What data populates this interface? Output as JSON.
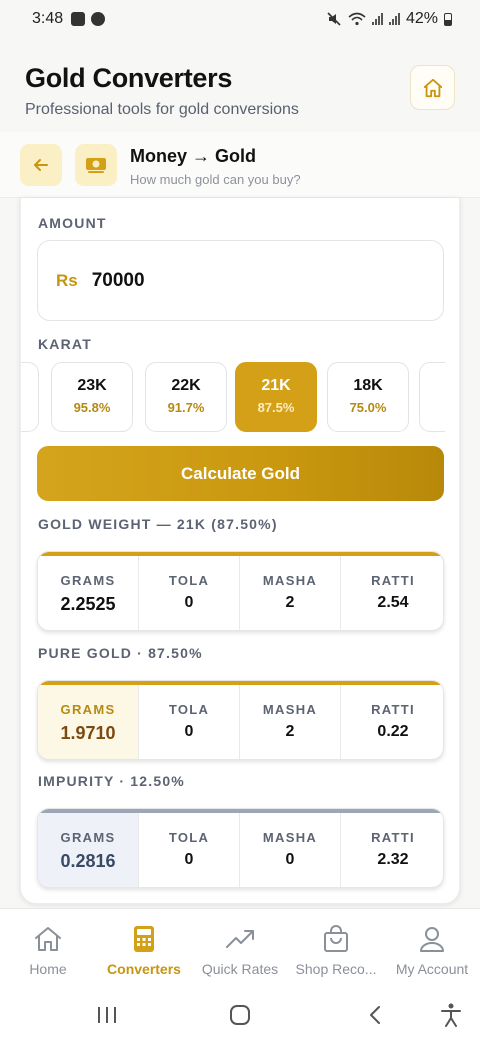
{
  "status": {
    "time": "3:48",
    "battery": "42%"
  },
  "header": {
    "title": "Gold Converters",
    "subtitle": "Professional tools for gold conversions"
  },
  "subheader": {
    "title": "Money → Gold",
    "hint": "How much gold can you buy?"
  },
  "form": {
    "amount_label": "AMOUNT",
    "currency": "Rs",
    "amount_value": "70000",
    "karat_label": "KARAT",
    "karats": [
      {
        "k": "23K",
        "p": "95.8%"
      },
      {
        "k": "22K",
        "p": "91.7%"
      },
      {
        "k": "21K",
        "p": "87.5%",
        "selected": true
      },
      {
        "k": "18K",
        "p": "75.0%"
      }
    ],
    "calculate_label": "Calculate Gold"
  },
  "results": {
    "gold_weight": {
      "label": "GOLD WEIGHT — 21K (87.50%)",
      "cols": [
        {
          "h": "GRAMS",
          "v": "2.2525"
        },
        {
          "h": "TOLA",
          "v": "0"
        },
        {
          "h": "MASHA",
          "v": "2"
        },
        {
          "h": "RATTI",
          "v": "2.54"
        }
      ]
    },
    "pure_gold": {
      "label": "PURE GOLD · 87.50%",
      "cols": [
        {
          "h": "GRAMS",
          "v": "1.9710"
        },
        {
          "h": "TOLA",
          "v": "0"
        },
        {
          "h": "MASHA",
          "v": "2"
        },
        {
          "h": "RATTI",
          "v": "0.22"
        }
      ]
    },
    "impurity": {
      "label": "IMPURITY · 12.50%",
      "cols": [
        {
          "h": "GRAMS",
          "v": "0.2816"
        },
        {
          "h": "TOLA",
          "v": "0"
        },
        {
          "h": "MASHA",
          "v": "0"
        },
        {
          "h": "RATTI",
          "v": "2.32"
        }
      ]
    }
  },
  "nav": [
    {
      "label": "Home",
      "icon": "home-icon"
    },
    {
      "label": "Converters",
      "icon": "calculator-icon",
      "active": true
    },
    {
      "label": "Quick Rates",
      "icon": "trending-up-icon"
    },
    {
      "label": "Shop Reco...",
      "icon": "shopping-bag-icon"
    },
    {
      "label": "My Account",
      "icon": "user-icon"
    }
  ],
  "colors": {
    "accent": "#d4a017",
    "accent_text": "#c7950f",
    "impurity_bar": "#9ca6b6"
  }
}
